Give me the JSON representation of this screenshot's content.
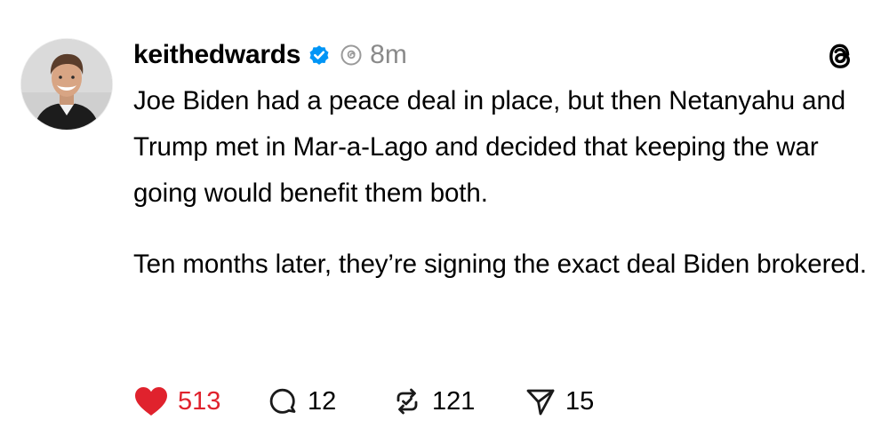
{
  "post": {
    "author": {
      "username": "keithedwards",
      "verified_icon": "verified-badge-icon",
      "avatar": "profile-photo"
    },
    "meta_icon": "threads-reply-icon",
    "time": "8m",
    "app_logo": "threads-logo-icon",
    "paragraphs": [
      "Joe Biden had a peace deal in place, but then Netanyahu and Trump met in Mar-a-Lago and decided that keeping the war going would benefit them both.",
      "Ten months later, they’re signing the exact deal Biden brokered."
    ],
    "actions": {
      "likes": "513",
      "comments": "12",
      "reposts": "121",
      "shares": "15"
    }
  },
  "colors": {
    "like_red": "#e0222d",
    "verified_blue": "#0095f6",
    "muted_gray": "#8a8a8a",
    "text": "#000000"
  }
}
